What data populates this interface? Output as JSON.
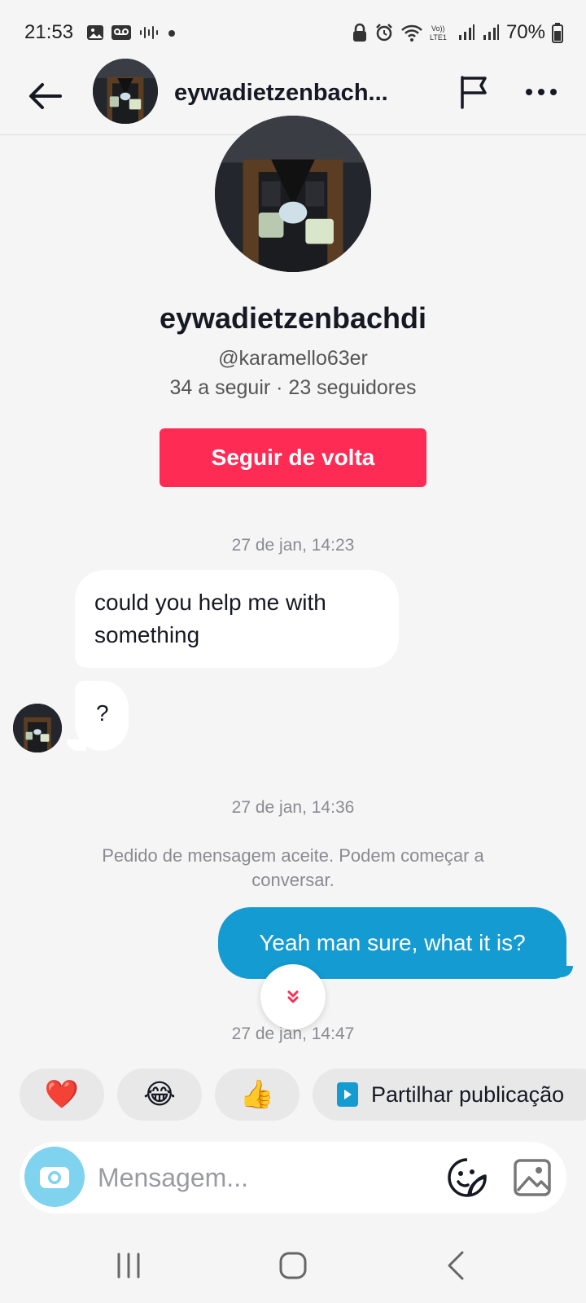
{
  "status_bar": {
    "time": "21:53",
    "battery": "70%",
    "icons_left": [
      "image-icon",
      "voicemail-icon",
      "audio-wave-icon",
      "notification-dot-icon"
    ],
    "icons_right": [
      "lock-icon",
      "alarm-icon",
      "wifi-icon",
      "volte-icon",
      "signal-icon",
      "signal-icon",
      "battery-icon"
    ]
  },
  "header": {
    "name": "eywadietzenbach...",
    "icons": [
      "back-arrow-icon",
      "flag-icon",
      "more-icon"
    ]
  },
  "profile": {
    "name": "eywadietzenbachdi",
    "handle": "@karamello63er",
    "stats": "34 a seguir · 23 seguidores",
    "follow_button": "Seguir de volta"
  },
  "messages": {
    "timestamp_1": "27 de jan, 14:23",
    "incoming_1": "could you help me with something",
    "incoming_2": "?",
    "timestamp_2": "27 de jan, 14:36",
    "system_notice": "Pedido de mensagem aceite. Podem começar a conversar.",
    "outgoing_1": "Yeah man sure, what it is?",
    "timestamp_3": "27 de jan, 14:47"
  },
  "quick_replies": {
    "heart": "❤️",
    "laugh": "😂",
    "thumbs_up": "👍",
    "share_label": "Partilhar publicação"
  },
  "composer": {
    "placeholder": "Mensagem..."
  },
  "colors": {
    "accent_red": "#fe2c55",
    "bubble_blue": "#149bd2",
    "camera_blue": "#7fd3ef",
    "background": "#f5f5f5"
  }
}
